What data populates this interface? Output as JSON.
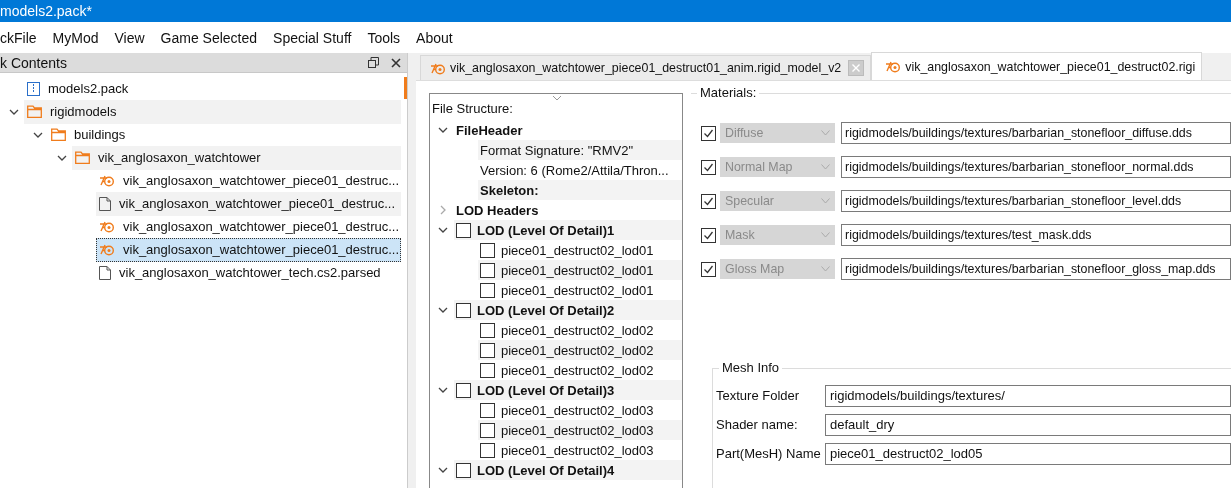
{
  "window": {
    "title": "models2.pack*"
  },
  "menu": [
    "ckFile",
    "MyMod",
    "View",
    "Game Selected",
    "Special Stuff",
    "Tools",
    "About"
  ],
  "pack_panel": {
    "title": "k Contents",
    "tree": [
      {
        "label": "models2.pack",
        "kind": "pack",
        "selected": false
      },
      {
        "label": "rigidmodels",
        "kind": "folder",
        "expanded": true,
        "selected": false,
        "children": [
          {
            "label": "buildings",
            "kind": "folder",
            "expanded": true,
            "selected": false,
            "children": [
              {
                "label": "vik_anglosaxon_watchtower",
                "kind": "folder",
                "expanded": true,
                "selected": false,
                "children": [
                  {
                    "label": "vik_anglosaxon_watchtower_piece01_destruc...",
                    "kind": "model",
                    "selected": false
                  },
                  {
                    "label": "vik_anglosaxon_watchtower_piece01_destruc...",
                    "kind": "file",
                    "selected": false
                  },
                  {
                    "label": "vik_anglosaxon_watchtower_piece01_destruc...",
                    "kind": "model",
                    "selected": false
                  },
                  {
                    "label": "vik_anglosaxon_watchtower_piece01_destruc...",
                    "kind": "model",
                    "selected": true
                  },
                  {
                    "label": "vik_anglosaxon_watchtower_tech.cs2.parsed",
                    "kind": "file",
                    "selected": false
                  }
                ]
              }
            ]
          }
        ]
      }
    ]
  },
  "tabs": [
    {
      "label": "vik_anglosaxon_watchtower_piece01_destruct01_anim.rigid_model_v2",
      "selected": false,
      "closable": true
    },
    {
      "label": "vik_anglosaxon_watchtower_piece01_destruct02.rigi",
      "selected": true,
      "closable": false
    }
  ],
  "file_structure": {
    "title": "File Structure:",
    "tree": [
      {
        "label": "FileHeader",
        "kind": "section",
        "expanded": true,
        "children": [
          {
            "label": "Format Signature: \"RMV2\"",
            "kind": "field"
          },
          {
            "label": "Version: 6 (Rome2/Attila/Thron...",
            "kind": "field"
          },
          {
            "label": "Skeleton:",
            "kind": "section"
          }
        ]
      },
      {
        "label": "LOD Headers",
        "kind": "section",
        "expanded": false
      },
      {
        "label": "LOD (Level Of Detail)1",
        "kind": "section",
        "expanded": true,
        "checked": false,
        "children": [
          {
            "label": "piece01_destruct02_lod01",
            "kind": "field",
            "checked": false
          },
          {
            "label": "piece01_destruct02_lod01",
            "kind": "field",
            "checked": false
          },
          {
            "label": "piece01_destruct02_lod01",
            "kind": "field",
            "checked": false
          }
        ]
      },
      {
        "label": "LOD (Level Of Detail)2",
        "kind": "section",
        "expanded": true,
        "checked": false,
        "children": [
          {
            "label": "piece01_destruct02_lod02",
            "kind": "field",
            "checked": false
          },
          {
            "label": "piece01_destruct02_lod02",
            "kind": "field",
            "checked": false
          },
          {
            "label": "piece01_destruct02_lod02",
            "kind": "field",
            "checked": false
          }
        ]
      },
      {
        "label": "LOD (Level Of Detail)3",
        "kind": "section",
        "expanded": true,
        "checked": false,
        "children": [
          {
            "label": "piece01_destruct02_lod03",
            "kind": "field",
            "checked": false
          },
          {
            "label": "piece01_destruct02_lod03",
            "kind": "field",
            "checked": false
          },
          {
            "label": "piece01_destruct02_lod03",
            "kind": "field",
            "checked": false
          }
        ]
      },
      {
        "label": "LOD (Level Of Detail)4",
        "kind": "section",
        "expanded": true,
        "checked": false
      }
    ]
  },
  "materials": {
    "title": "Materials:",
    "rows": [
      {
        "type": "Diffuse",
        "checked": true,
        "path": "rigidmodels/buildings/textures/barbarian_stonefloor_diffuse.dds"
      },
      {
        "type": "Normal Map",
        "checked": true,
        "path": "rigidmodels/buildings/textures/barbarian_stonefloor_normal.dds"
      },
      {
        "type": "Specular",
        "checked": true,
        "path": "rigidmodels/buildings/textures/barbarian_stonefloor_level.dds"
      },
      {
        "type": "Mask",
        "checked": true,
        "path": "rigidmodels/buildings/textures/test_mask.dds"
      },
      {
        "type": "Gloss Map",
        "checked": true,
        "path": "rigidmodels/buildings/textures/barbarian_stonefloor_gloss_map.dds"
      }
    ]
  },
  "mesh_info": {
    "title": "Mesh Info",
    "fields": [
      {
        "label": "Texture Folder",
        "value": "rigidmodels/buildings/textures/"
      },
      {
        "label": "Shader name:",
        "value": "default_dry"
      },
      {
        "label": "Part(MesH) Name",
        "value": "piece01_destruct02_lod05"
      }
    ]
  }
}
